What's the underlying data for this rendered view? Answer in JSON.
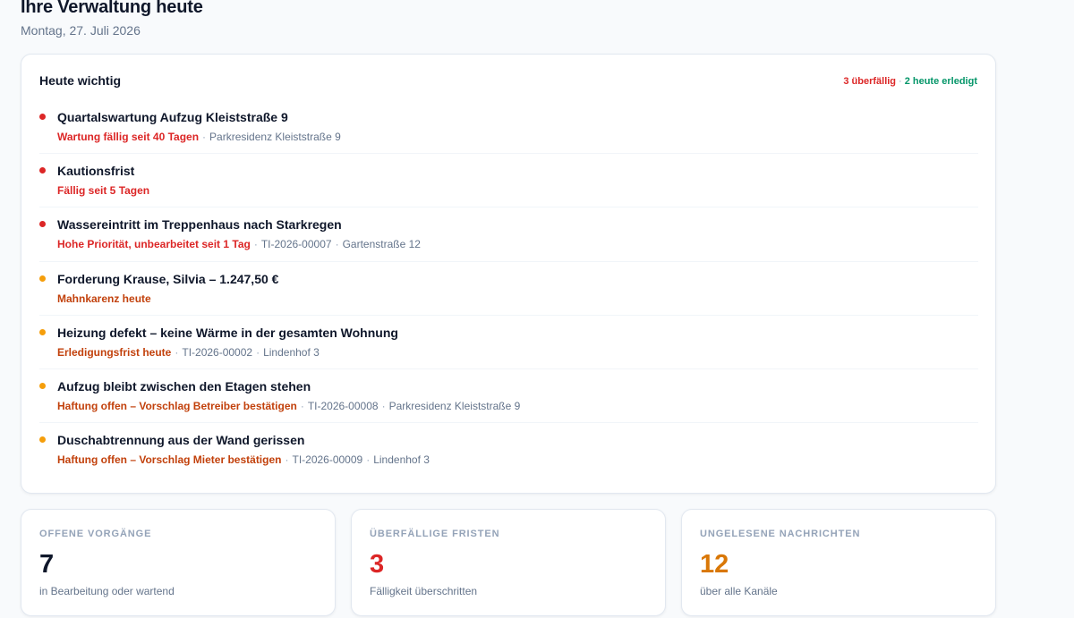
{
  "header": {
    "title": "Ihre Verwaltung heute",
    "date": "Montag, 27. Juli 2026"
  },
  "today": {
    "title": "Heute wichtig",
    "summary_overdue": "3 überfällig",
    "summary_separator": "·",
    "summary_done": "2 heute erledigt",
    "items": [
      {
        "title": "Quartalswartung Aufzug Kleiststraße 9",
        "status": "Wartung fällig seit 40 Tagen",
        "severity": "red",
        "meta": [
          "Parkresidenz Kleiststraße 9"
        ]
      },
      {
        "title": "Kautionsfrist",
        "status": "Fällig seit 5 Tagen",
        "severity": "red",
        "meta": []
      },
      {
        "title": "Wassereintritt im Treppenhaus nach Starkregen",
        "status": "Hohe Priorität, unbearbeitet seit 1 Tag",
        "severity": "red",
        "meta": [
          "TI-2026-00007",
          "Gartenstraße 12"
        ]
      },
      {
        "title": "Forderung Krause, Silvia – 1.247,50 €",
        "status": "Mahnkarenz heute",
        "severity": "amber",
        "meta": []
      },
      {
        "title": "Heizung defekt – keine Wärme in der gesamten Wohnung",
        "status": "Erledigungsfrist heute",
        "severity": "amber",
        "meta": [
          "TI-2026-00002",
          "Lindenhof 3"
        ]
      },
      {
        "title": "Aufzug bleibt zwischen den Etagen stehen",
        "status": "Haftung offen – Vorschlag Betreiber bestätigen",
        "severity": "amber",
        "meta": [
          "TI-2026-00008",
          "Parkresidenz Kleiststraße 9"
        ]
      },
      {
        "title": "Duschabtrennung aus der Wand gerissen",
        "status": "Haftung offen – Vorschlag Mieter bestätigen",
        "severity": "amber",
        "meta": [
          "TI-2026-00009",
          "Lindenhof 3"
        ]
      }
    ]
  },
  "stats": [
    {
      "label": "Offene Vorgänge",
      "value": "7",
      "sub": "in Bearbeitung oder wartend",
      "color": "#0f172a"
    },
    {
      "label": "Überfällige Fristen",
      "value": "3",
      "sub": "Fälligkeit überschritten",
      "color": "#dc2626"
    },
    {
      "label": "Ungelesene Nachrichten",
      "value": "12",
      "sub": "über alle Kanäle",
      "color": "#d97706"
    }
  ],
  "colors": {
    "red": "#dc2626",
    "amber": "#f59e0b",
    "green": "#059669"
  }
}
